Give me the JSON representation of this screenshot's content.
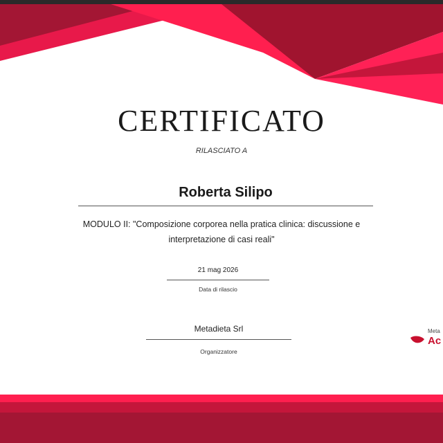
{
  "certificate": {
    "title": "CERTIFICATO",
    "subtitle": "RILASCIATO A",
    "recipient_name": "Roberta Silipo",
    "course_line_1": "MODULO II: \"Composizione corporea nella pratica clinica: discussione e",
    "course_line_2": "interpretazione di casi reali\"",
    "issue_date": "21 mag 2026",
    "issue_date_label": "Data di rilascio",
    "organizer": "Metadieta Srl",
    "organizer_label": "Organizzatore"
  },
  "logo": {
    "small_text": "Meta",
    "big_text": "Ac",
    "icon": "leaf-icon"
  },
  "colors": {
    "accent_bright": "#ff1f4f",
    "accent_dark": "#a0142f",
    "accent_mid": "#d41a43",
    "text": "#1a1a1a"
  }
}
